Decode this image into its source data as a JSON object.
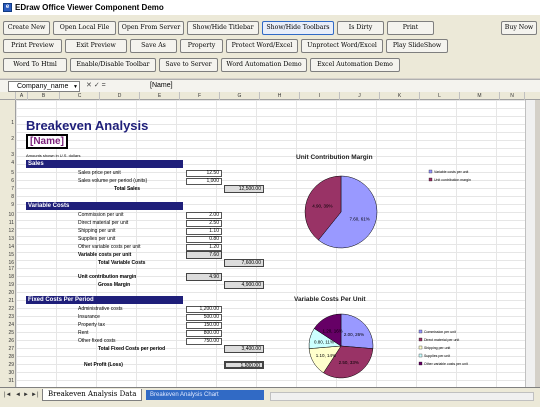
{
  "window": {
    "title": "EDraw Office Viewer Component Demo"
  },
  "toolbar": {
    "row1": [
      "Create New",
      "Open Local File",
      "Open From Server",
      "Show/Hide Titlebar",
      "Show/Hide Toolbars",
      "Is Dirty",
      "Print",
      "Buy Now"
    ],
    "row2": [
      "Print Preview",
      "Exit Preview",
      "Save As",
      "Property",
      "Protect Word/Excel",
      "Unprotect Word/Excel",
      "Play SlideShow"
    ],
    "row3": [
      "Word To Html",
      "Enable/Disable Toolbar",
      "Save to Server",
      "Word Automation Demo",
      "Excel Automation Demo"
    ]
  },
  "formula_bar": {
    "name_box": "Company_name",
    "value": "[Name]"
  },
  "columns": [
    "A",
    "B",
    "C",
    "D",
    "E",
    "F",
    "G",
    "H",
    "I",
    "J",
    "K",
    "L",
    "M",
    "N"
  ],
  "rows": [
    "1",
    "2",
    "3",
    "4",
    "5",
    "6",
    "7",
    "8",
    "9",
    "10",
    "11",
    "12",
    "13",
    "14",
    "15",
    "16",
    "17",
    "18",
    "19",
    "20",
    "21",
    "22",
    "23",
    "24",
    "25",
    "26",
    "27",
    "28",
    "29",
    "30",
    "31"
  ],
  "sheet": {
    "title": "Breakeven Analysis",
    "name_field": "[Name]",
    "note": "Amounts shown in U.S. dollars",
    "sales": {
      "header": "Sales",
      "price_label": "Sales price per unit",
      "price": "12.50",
      "volume_label": "Sales volume per period (units)",
      "volume": "1,000",
      "total_label": "Total Sales",
      "total": "12,500.00"
    },
    "variable": {
      "header": "Variable Costs",
      "items": [
        {
          "label": "Commission per unit",
          "value": "2.00"
        },
        {
          "label": "Direct material per unit",
          "value": "2.50"
        },
        {
          "label": "Shipping per unit",
          "value": "1.10"
        },
        {
          "label": "Supplies per unit",
          "value": "0.80"
        },
        {
          "label": "Other variable costs per unit",
          "value": "1.20"
        }
      ],
      "per_unit_label": "Variable costs per unit",
      "per_unit": "7.60",
      "total_label": "Total Variable Costs",
      "total": "7,600.00",
      "margin_label": "Unit contribution margin",
      "margin": "4.90",
      "gross_label": "Gross Margin",
      "gross": "4,900.00"
    },
    "fixed": {
      "header": "Fixed Costs Per Period",
      "items": [
        {
          "label": "Administrative costs",
          "value": "1,200.00"
        },
        {
          "label": "Insurance",
          "value": "500.00"
        },
        {
          "label": "Property tax",
          "value": "150.00"
        },
        {
          "label": "Rent",
          "value": "800.00"
        },
        {
          "label": "Other fixed costs",
          "value": "750.00"
        }
      ],
      "total_label": "Total Fixed Costs per period",
      "total": "3,400.00",
      "profit_label": "Net Profit (Loss)",
      "profit": "1,500.00"
    }
  },
  "chart_data": [
    {
      "type": "pie",
      "title": "Unit Contribution Margin",
      "categories": [
        "Variable costs per unit",
        "Unit contribution margin"
      ],
      "values": [
        7.6,
        4.9
      ],
      "data_labels": [
        "7.60, 61%",
        "4.90, 39%"
      ],
      "colors": [
        "#9999ff",
        "#993366"
      ],
      "legend": "right"
    },
    {
      "type": "pie",
      "title": "Variable Costs Per Unit",
      "categories": [
        "Commission per unit",
        "Direct material per unit",
        "Shipping per unit",
        "Supplies per unit",
        "Other variable costs per unit"
      ],
      "values": [
        2.0,
        2.5,
        1.1,
        0.8,
        1.2
      ],
      "data_labels": [
        "2.00, 26%",
        "2.50, 33%",
        "1.10, 14%",
        "0.80, 11%",
        "1.20, 16%"
      ],
      "colors": [
        "#9999ff",
        "#993366",
        "#ffffcc",
        "#ccffff",
        "#660066"
      ],
      "legend": "right"
    }
  ],
  "tabs": {
    "active": "Breakeven Analysis Data",
    "second": "Breakeven Analysis Chart"
  },
  "nav": {
    "first": "|◄",
    "prev": "◄",
    "next": "►",
    "last": "►|"
  }
}
